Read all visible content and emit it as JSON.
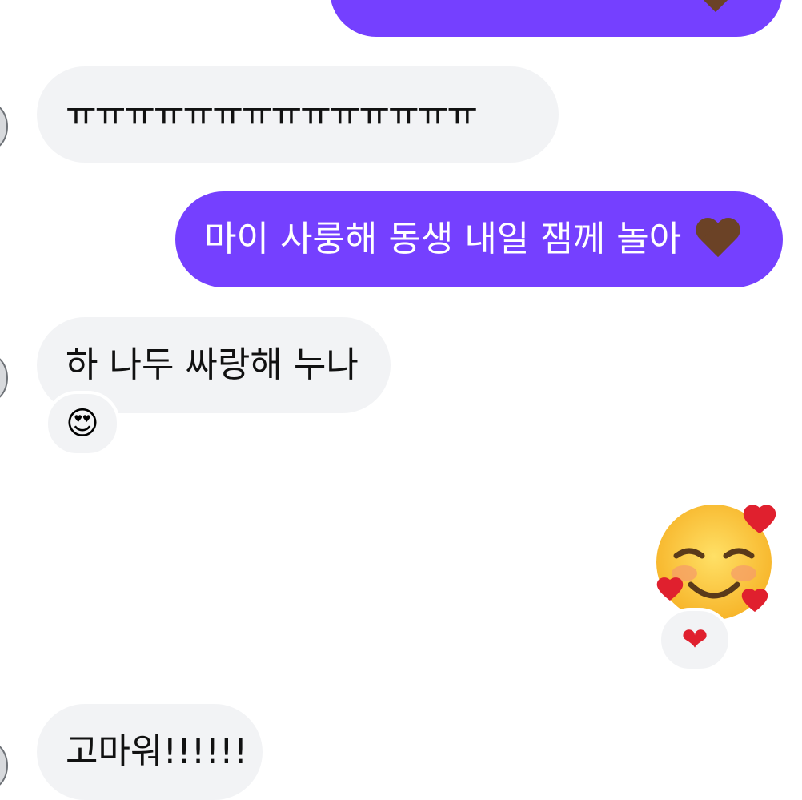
{
  "messages": [
    {
      "id": "m0",
      "direction": "outgoing",
      "text": "",
      "emoji": "heart-brown"
    },
    {
      "id": "m1",
      "direction": "incoming",
      "text": "ㅠㅠㅠㅠㅠㅠㅠㅠㅠㅠㅠㅠㅠㅠ"
    },
    {
      "id": "m2",
      "direction": "outgoing",
      "text": "마이 사룽해 동생 내일 잼께 놀아",
      "emoji": "heart-brown"
    },
    {
      "id": "m3",
      "direction": "incoming",
      "text": "하 나두 싸랑해 누나",
      "reaction": "😍"
    },
    {
      "id": "m4",
      "direction": "outgoing",
      "emoji": "smiling-face-with-hearts",
      "reaction": "❤"
    },
    {
      "id": "m5",
      "direction": "incoming",
      "text": "고마워!!!!!!"
    }
  ],
  "colors": {
    "outgoing_bubble": "#7540ff",
    "incoming_bubble": "#f2f3f5",
    "outgoing_text": "#ffffff",
    "incoming_text": "#111111",
    "heart_brown": "#6b4226",
    "heart_red": "#e0202e",
    "emoji_face": "#fcc63a"
  }
}
